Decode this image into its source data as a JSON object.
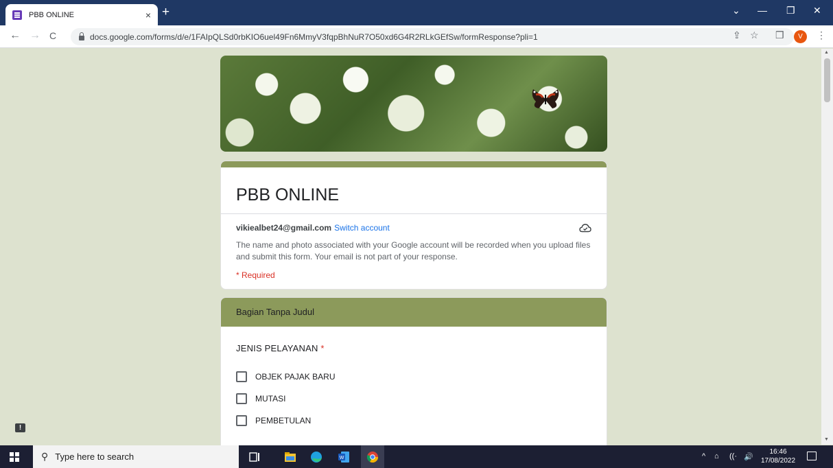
{
  "browser": {
    "tab_title": "PBB ONLINE",
    "tab_close": "×",
    "new_tab": "+",
    "url": "docs.google.com/forms/d/e/1FAIpQLSd0rbKIO6uel49Fn6MmyV3fqpBhNuR7O50xd6G4R2RLkGEfSw/formResponse?pli=1",
    "back": "←",
    "forward": "→",
    "reload": "C",
    "profile_initial": "V",
    "window_controls": {
      "chevron": "⌄",
      "minimize": "—",
      "restore": "❐",
      "close": "✕"
    },
    "toolbar_icons": {
      "share": "⇪",
      "star": "☆",
      "sidepanel": "❒",
      "menu": "⋮"
    }
  },
  "form": {
    "title": "PBB ONLINE",
    "account_email": "vikiealbet24@gmail.com",
    "switch_account": "Switch account",
    "privacy_notice": "The name and photo associated with your Google account will be recorded when you upload files and submit this form. Your email is not part of your response.",
    "required_note": "* Required",
    "section_title": "Bagian Tanpa Judul",
    "question": {
      "label": "JENIS PELAYANAN",
      "required_mark": "*",
      "options": [
        "OBJEK PAJAK BARU",
        "MUTASI",
        "PEMBETULAN"
      ]
    }
  },
  "taskbar": {
    "search_placeholder": "Type here to search",
    "time": "16:46",
    "date": "17/08/2022",
    "tray": {
      "up_arrow": "^",
      "network": "⌂",
      "wifi": "((·",
      "volume": "🔊"
    }
  },
  "colors": {
    "page_bg": "#dde2cf",
    "accent": "#8c9a5b",
    "title_bar": "#1f3864",
    "required": "#d93025",
    "link": "#1a73e8"
  }
}
